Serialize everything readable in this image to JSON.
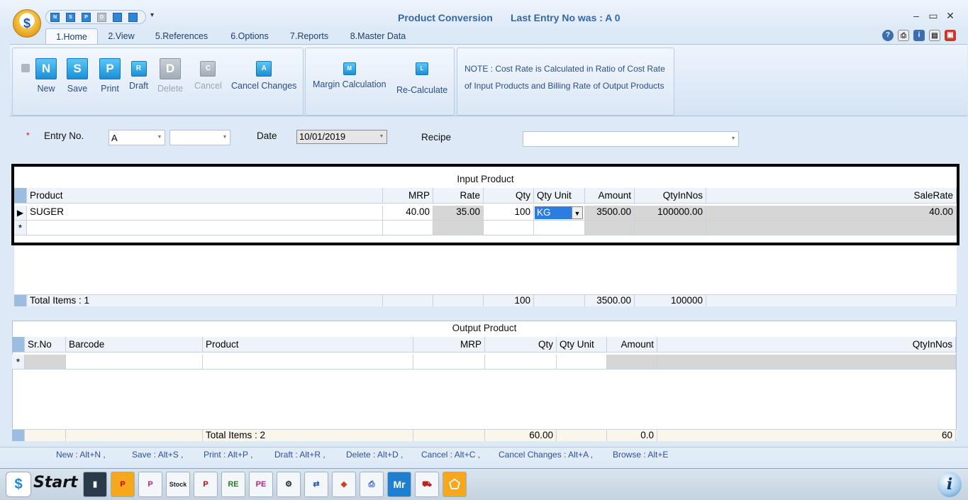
{
  "window": {
    "title": "Product Conversion",
    "last_entry": "Last Entry No was : A 0",
    "logo_glyph": "$",
    "quick_access": [
      "N",
      "S",
      "P",
      "D",
      "",
      ""
    ],
    "controls": {
      "minimize": "–",
      "maximize": "▭",
      "close": "✕"
    }
  },
  "tabs": [
    "1.Home",
    "2.View",
    "5.References",
    "6.Options",
    "7.Reports",
    "8.Master Data"
  ],
  "header_icons": [
    "?",
    "⎙",
    "i",
    "▤",
    "▣"
  ],
  "ribbon": {
    "new": {
      "label": "New",
      "glyph": "N"
    },
    "save": {
      "label": "Save",
      "glyph": "S"
    },
    "print": {
      "label": "Print",
      "glyph": "P"
    },
    "draft": {
      "label": "Draft",
      "glyph": "R"
    },
    "delete": {
      "label": "Delete",
      "glyph": "D"
    },
    "cancel": {
      "label": "Cancel",
      "glyph": "C"
    },
    "cancel_changes": {
      "label": "Cancel Changes",
      "glyph": "A"
    },
    "margin_calc": {
      "label": "Margin Calculation",
      "glyph": "M"
    },
    "recalc": {
      "label": "Re-Calculate",
      "glyph": "L"
    },
    "note_line1": "NOTE : Cost Rate is Calculated in Ratio of Cost Rate",
    "note_line2": "of Input Products and Billing Rate of Output Products"
  },
  "form": {
    "required_mark": "*",
    "entry_label": "Entry No.",
    "entry_prefix": "A",
    "entry_number": "",
    "date_label": "Date",
    "date_value": "10/01/2019",
    "recipe_label": "Recipe",
    "recipe_value": "",
    "combo_arrow": "▼"
  },
  "input_grid": {
    "title": "Input Product",
    "columns": [
      "Product",
      "MRP",
      "Rate",
      "Qty",
      "Qty Unit",
      "Amount",
      "QtyInNos",
      "SaleRate"
    ],
    "rows": [
      {
        "product": "SUGER",
        "mrp": "40.00",
        "rate": "35.00",
        "qty": "100",
        "unit": "KG",
        "amount": "3500.00",
        "qtyinnos": "100000.00",
        "salerate": "40.00"
      }
    ],
    "current_marker": "▶",
    "new_marker": "*",
    "totals": {
      "label": "Total Items : 1",
      "qty": "100",
      "amount": "3500.00",
      "qtyinnos": "100000"
    }
  },
  "output_grid": {
    "title": "Output Product",
    "columns": [
      "Sr.No",
      "Barcode",
      "Product",
      "MRP",
      "Qty",
      "Qty Unit",
      "Amount",
      "QtyInNos"
    ],
    "new_marker": "*",
    "totals": {
      "label": "Total Items : 2",
      "qty": "60.00",
      "amount": "0.0",
      "qtyinnos": "60"
    }
  },
  "shortcuts": [
    "New : Alt+N ,",
    "Save : Alt+S ,",
    "Print : Alt+P ,",
    "Draft : Alt+R ,",
    "Delete : Alt+D ,",
    "Cancel : Alt+C ,",
    "Cancel Changes : Alt+A ,",
    "Browse : Alt+E"
  ],
  "taskbar": {
    "start_label": "Start",
    "start_glyph": "$",
    "apps": [
      "▮",
      "P",
      "P",
      "Stock",
      "P",
      "RE",
      "PE",
      "⚙",
      "⇄",
      "◆",
      "⎙",
      "Mr",
      "⛟",
      "⬠"
    ],
    "info_glyph": "i",
    "colors": {
      "app_highlight": "#f6a81c"
    }
  }
}
